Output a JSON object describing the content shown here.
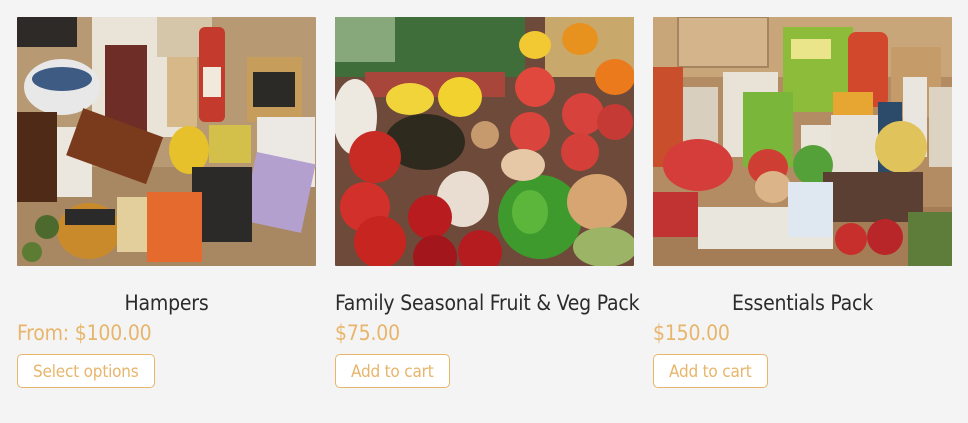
{
  "products": [
    {
      "title": "Hampers",
      "price": "From: $100.00",
      "button": "Select options",
      "image_alt": "hampers-photo"
    },
    {
      "title": "Family Seasonal Fruit & Veg Pack",
      "price": "$75.00",
      "button": "Add to cart",
      "image_alt": "fruit-veg-photo"
    },
    {
      "title": "Essentials Pack",
      "price": "$150.00",
      "button": "Add to cart",
      "image_alt": "essentials-photo"
    }
  ],
  "colors": {
    "accent": "#e7b56b",
    "title": "#2b2b2b",
    "background": "#f5f4f4"
  }
}
